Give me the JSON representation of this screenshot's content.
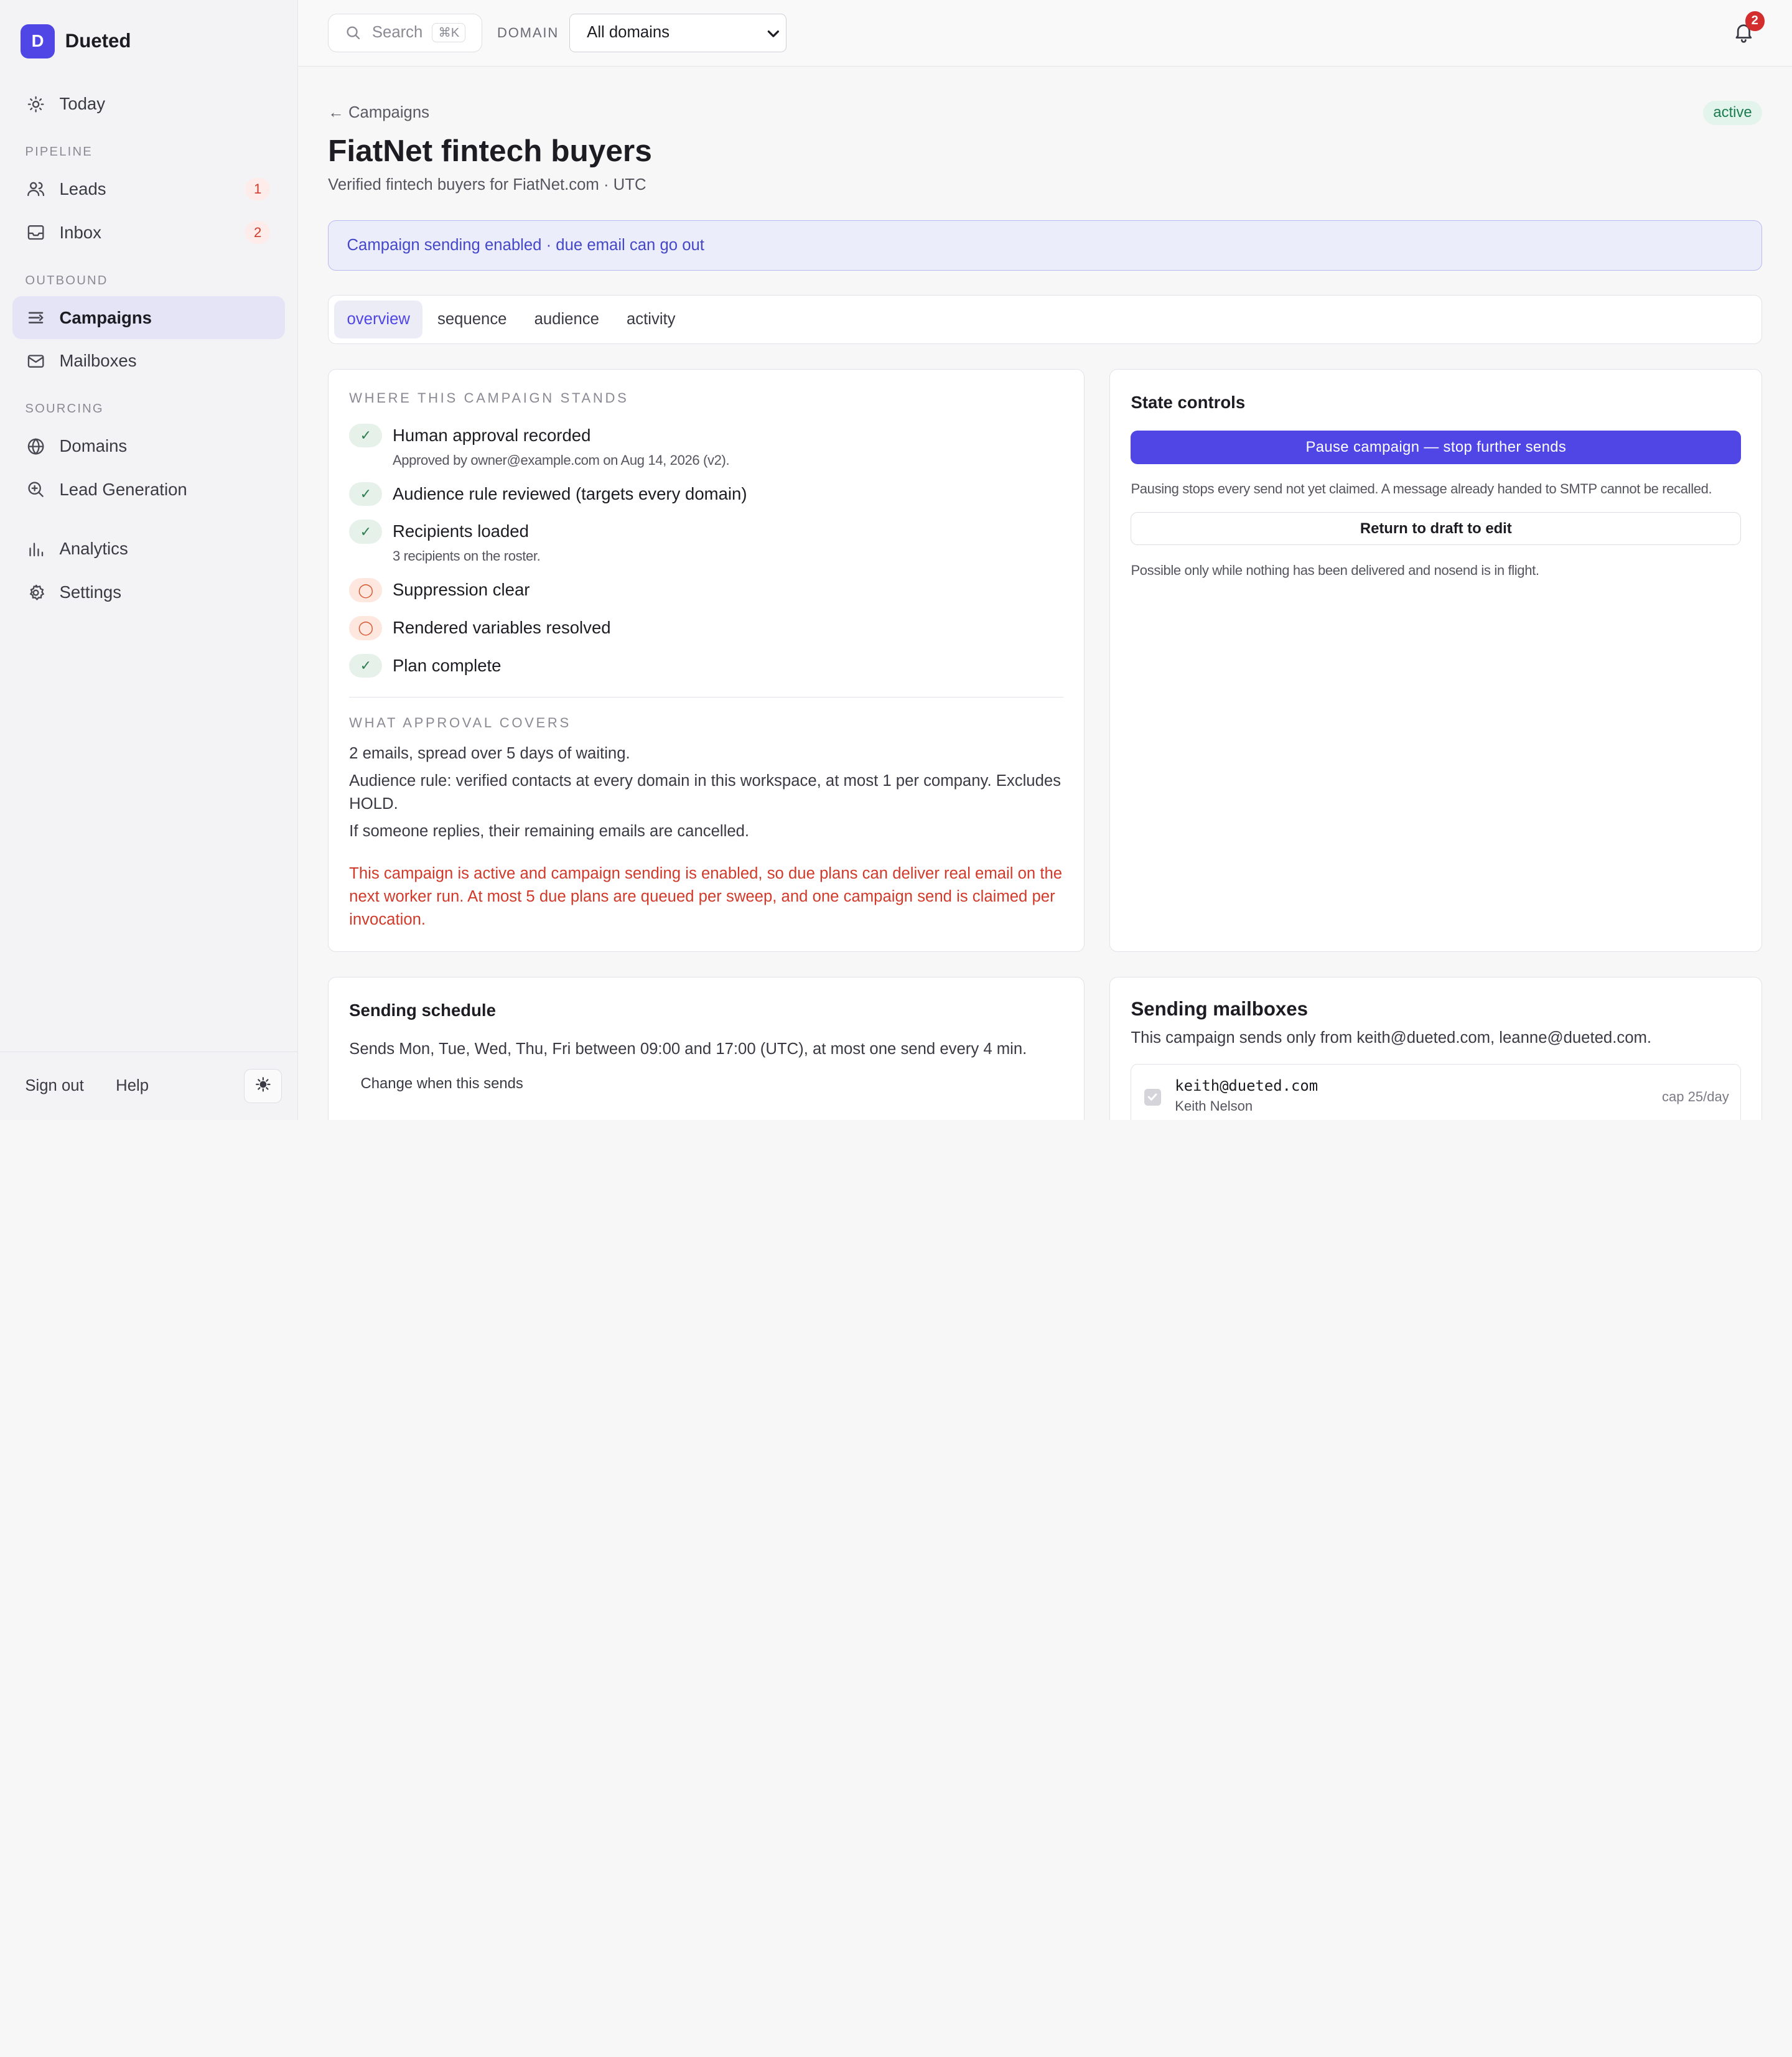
{
  "app": {
    "logo_letter": "D",
    "name": "Dueted"
  },
  "sidebar": {
    "today": "Today",
    "pipeline_label": "PIPELINE",
    "leads": "Leads",
    "leads_count": "1",
    "inbox": "Inbox",
    "inbox_count": "2",
    "outbound_label": "OUTBOUND",
    "campaigns": "Campaigns",
    "mailboxes": "Mailboxes",
    "sourcing_label": "SOURCING",
    "domains": "Domains",
    "lead_generation": "Lead Generation",
    "analytics": "Analytics",
    "settings": "Settings",
    "sign_out": "Sign out",
    "help": "Help"
  },
  "topbar": {
    "search_placeholder": "Search",
    "search_shortcut": "⌘K",
    "domain_label": "DOMAIN",
    "domain_value": "All domains",
    "notifications_count": "2"
  },
  "page": {
    "back_link": "← Campaigns",
    "status": "active",
    "title": "FiatNet fintech buyers",
    "subtitle": "Verified fintech buyers for FiatNet.com · UTC",
    "banner": "Campaign sending enabled · due email can go out"
  },
  "tabs": [
    "overview",
    "sequence",
    "audience",
    "activity"
  ],
  "stand": {
    "label": "WHERE THIS CAMPAIGN STANDS",
    "items": [
      {
        "title": "Human approval recorded",
        "note": "Approved by owner@example.com on Aug 14, 2026 (v2).",
        "state": "ok",
        "mark": "✓"
      },
      {
        "title": "Audience rule reviewed (targets every domain)",
        "note": "",
        "state": "ok",
        "mark": "✓"
      },
      {
        "title": "Recipients loaded",
        "note": "3 recipients on the roster.",
        "state": "ok",
        "mark": "✓"
      },
      {
        "title": "Suppression clear",
        "note": "",
        "state": "pending",
        "mark": "◯"
      },
      {
        "title": "Rendered variables resolved",
        "note": "",
        "state": "pending",
        "mark": "◯"
      },
      {
        "title": "Plan complete",
        "note": "",
        "state": "ok",
        "mark": "✓"
      }
    ],
    "approval_label": "WHAT APPROVAL COVERS",
    "approval_1": "2 emails, spread over 5 days of waiting.",
    "approval_2": "Audience rule: verified contacts at every domain in this workspace, at most 1 per company. Excludes HOLD.",
    "approval_3": "If someone replies, their remaining emails are cancelled.",
    "warning": "This campaign is active and campaign sending is enabled, so due plans can deliver real email on the next worker run. At most 5 due plans are queued per sweep, and one campaign send is claimed per invocation."
  },
  "state": {
    "title": "State controls",
    "pause_button": "Pause campaign — stop further sends",
    "pause_note": "Pausing stops every send not yet claimed. A message already handed to SMTP cannot be recalled.",
    "draft_button": "Return to draft to edit",
    "draft_note": "Possible only while nothing has been delivered and nosend is in flight."
  },
  "schedule": {
    "title": "Sending schedule",
    "text": "Sends Mon, Tue, Wed, Thu, Fri between 09:00 and 17:00 (UTC), at most one send every 4 min.",
    "change_link": "Change when this sends"
  },
  "mailboxes": {
    "title": "Sending mailboxes",
    "text": "This campaign sends only from keith@dueted.com, leanne@dueted.com.",
    "rows": [
      {
        "email": "keith@dueted.com",
        "name": "Keith Nelson",
        "cap": "cap 25/day"
      }
    ]
  }
}
